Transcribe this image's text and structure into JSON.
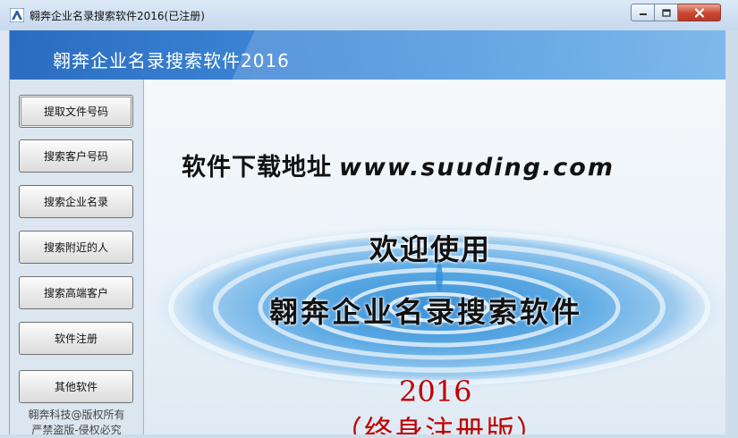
{
  "window": {
    "title": "翱奔企业名录搜索软件2016(已注册)"
  },
  "banner": {
    "title": "翱奔企业名录搜索软件2016"
  },
  "sidebar": {
    "buttons": [
      {
        "label": "提取文件号码"
      },
      {
        "label": "搜索客户号码"
      },
      {
        "label": "搜索企业名录"
      },
      {
        "label": "搜索附近的人"
      },
      {
        "label": "搜索高端客户"
      },
      {
        "label": "软件注册"
      },
      {
        "label": "其他软件"
      }
    ],
    "copyright_line1": "翱奔科技@版权所有",
    "copyright_line2": "严禁盗版-侵权必究"
  },
  "content": {
    "download_label": "软件下载地址",
    "download_url": "www.suuding.com",
    "welcome": "欢迎使用",
    "product_name": "翱奔企业名录搜索软件",
    "year": "2016",
    "edition": "（终身注册版）"
  },
  "icons": {
    "app": "app-logo-icon",
    "minimize": "minimize-icon",
    "maximize": "maximize-icon",
    "close": "close-icon"
  },
  "colors": {
    "banner_blue": "#3e86d6",
    "edition_red": "#c00000",
    "close_red": "#c9452f"
  }
}
